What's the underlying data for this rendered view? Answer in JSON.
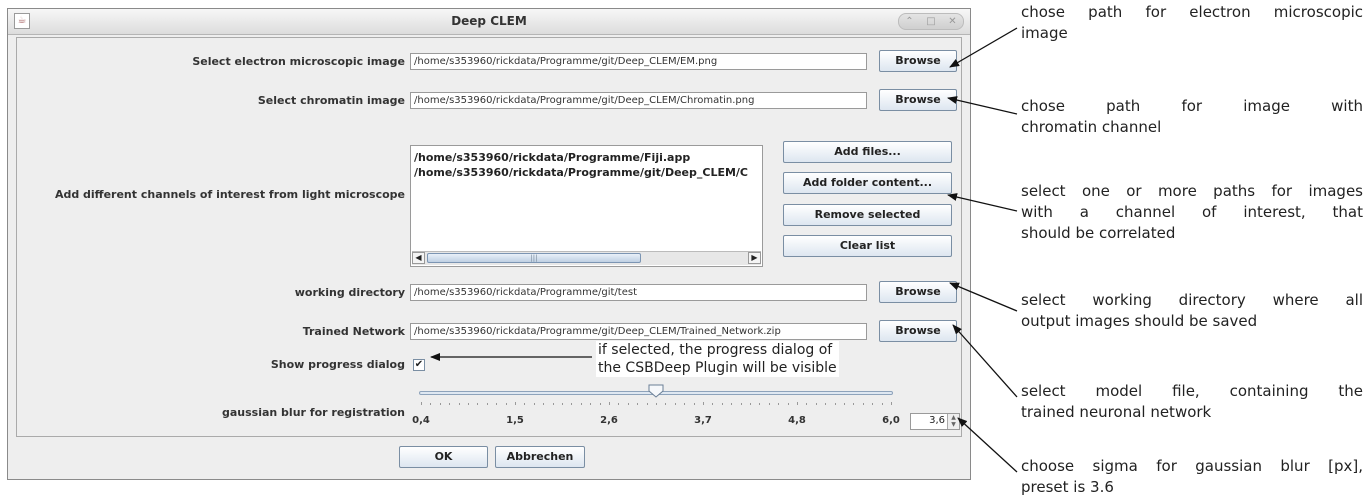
{
  "window": {
    "title": "Deep CLEM"
  },
  "em_image": {
    "label": "Select electron microscopic image",
    "value": "/home/s353960/rickdata/Programme/git/Deep_CLEM/EM.png",
    "button": "Browse"
  },
  "chromatin_image": {
    "label": "Select chromatin image",
    "value": "/home/s353960/rickdata/Programme/git/Deep_CLEM/Chromatin.png",
    "button": "Browse"
  },
  "channels": {
    "label": "Add different channels of interest from light microscope",
    "items": [
      "/home/s353960/rickdata/Programme/Fiji.app",
      "/home/s353960/rickdata/Programme/git/Deep_CLEM/C"
    ],
    "buttons": {
      "add_files": "Add files...",
      "add_folder": "Add folder content...",
      "remove": "Remove selected",
      "clear": "Clear list"
    }
  },
  "working_dir": {
    "label": "working directory",
    "value": "/home/s353960/rickdata/Programme/git/test",
    "button": "Browse"
  },
  "trained_network": {
    "label": "Trained Network",
    "value": "/home/s353960/rickdata/Programme/git/Deep_CLEM/Trained_Network.zip",
    "button": "Browse"
  },
  "progress_dialog": {
    "label": "Show progress dialog",
    "checked": true,
    "check_glyph": "✔"
  },
  "blur": {
    "label": "gaussian blur for registration",
    "ticks": [
      "0,4",
      "1,5",
      "2,6",
      "3,7",
      "4,8",
      "6,0"
    ],
    "value": "3,6",
    "slider_fraction": 0.5
  },
  "dialog_buttons": {
    "ok": "OK",
    "cancel": "Abbrechen"
  },
  "annotations": {
    "em_l1": "chose path for electron microscopic",
    "em_l2": "image",
    "chrom_l1": "chose path for image with",
    "chrom_l2": "chromatin channel",
    "ch_l1": "select one or more paths for images",
    "ch_l2": "with a channel of interest, that",
    "ch_l3": "should be correlated",
    "wd_l1": "select working directory where all",
    "wd_l2": "output images should be saved",
    "model_l1": "select model file, containing the",
    "model_l2": "trained neuronal network",
    "sigma_l1": "choose sigma for gaussian blur [px],",
    "sigma_l2": "preset is 3.6",
    "progress_l1": "if selected, the progress dialog of",
    "progress_l2": "the CSBDeep Plugin will be visible"
  }
}
